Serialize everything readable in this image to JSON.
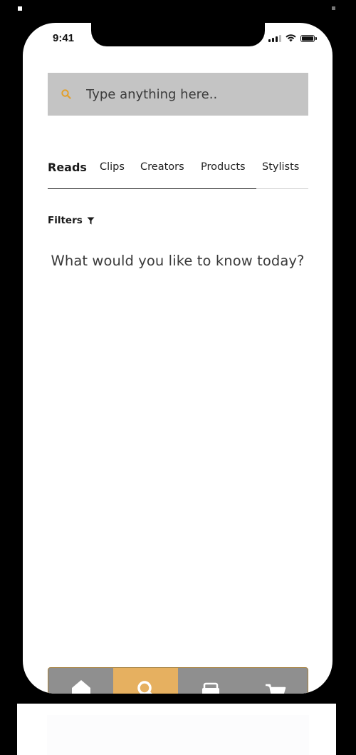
{
  "status_bar": {
    "time": "9:41"
  },
  "search": {
    "placeholder": "Type anything here..",
    "value": "",
    "icon": "search-icon",
    "icon_color": "#e3a02a"
  },
  "tabs": [
    {
      "label": "Reads",
      "active": true
    },
    {
      "label": "Clips",
      "active": false
    },
    {
      "label": "Creators",
      "active": false
    },
    {
      "label": "Products",
      "active": false
    },
    {
      "label": "Stylists",
      "active": false
    }
  ],
  "filters": {
    "label": "Filters",
    "icon": "filter-icon"
  },
  "main": {
    "prompt": "What would you like to know today?"
  },
  "bottom_nav": {
    "items": [
      {
        "name": "home",
        "icon": "home-icon",
        "active": false
      },
      {
        "name": "search",
        "icon": "search-icon",
        "active": true
      },
      {
        "name": "wardrobe",
        "icon": "sofa-icon",
        "active": false
      },
      {
        "name": "cart",
        "icon": "cart-icon",
        "active": false
      }
    ],
    "active_color": "#e6b060",
    "inactive_color": "#8f8f8f",
    "border_color": "#a37e3a"
  }
}
